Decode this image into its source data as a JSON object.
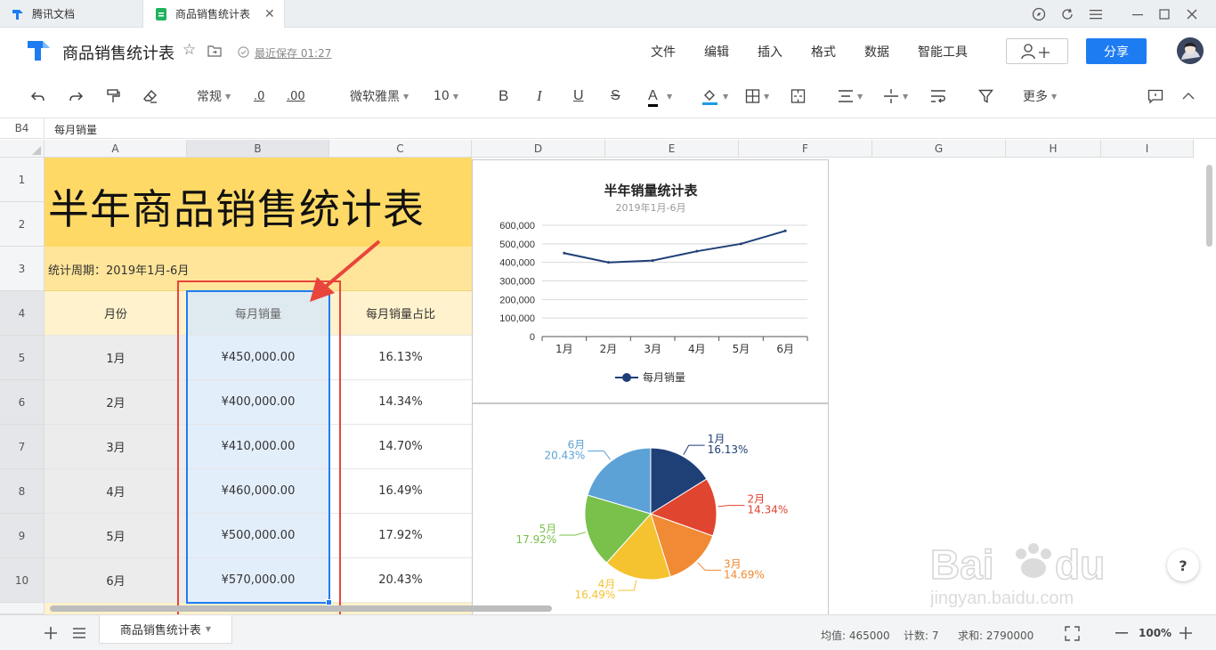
{
  "tabs": [
    {
      "label": "腾讯文档"
    },
    {
      "label": "商品销售统计表"
    }
  ],
  "header": {
    "doc_title": "商品销售统计表",
    "save_status": "最近保存 01:27",
    "menu": [
      "文件",
      "编辑",
      "插入",
      "格式",
      "数据",
      "智能工具"
    ],
    "share_label": "分享"
  },
  "toolbar": {
    "format_label": "常规",
    "decimal_dec": ".0",
    "decimal_inc": ".00",
    "font_name": "微软雅黑",
    "font_size": "10",
    "more_label": "更多",
    "bold": "B",
    "italic": "I",
    "underline": "U",
    "strike": "S",
    "font_color": "A"
  },
  "formula_bar": {
    "cell_ref": "B4",
    "content": "每月销量"
  },
  "columns": [
    "A",
    "B",
    "C",
    "D",
    "E",
    "F",
    "G",
    "H",
    "I"
  ],
  "rows": [
    "1",
    "2",
    "3",
    "4",
    "5",
    "6",
    "7",
    "8",
    "9",
    "10"
  ],
  "sheet": {
    "title": "半年商品销售统计表",
    "period": "统计周期：2019年1月-6月",
    "headers": [
      "月份",
      "每月销量",
      "每月销量占比"
    ],
    "data": [
      [
        "1月",
        "¥450,000.00",
        "16.13%"
      ],
      [
        "2月",
        "¥400,000.00",
        "14.34%"
      ],
      [
        "3月",
        "¥410,000.00",
        "14.70%"
      ],
      [
        "4月",
        "¥460,000.00",
        "16.49%"
      ],
      [
        "5月",
        "¥500,000.00",
        "17.92%"
      ],
      [
        "6月",
        "¥570,000.00",
        "20.43%"
      ]
    ]
  },
  "chart_data": [
    {
      "type": "line",
      "title": "半年销量统计表",
      "subtitle": "2019年1月-6月",
      "categories": [
        "1月",
        "2月",
        "3月",
        "4月",
        "5月",
        "6月"
      ],
      "series": [
        {
          "name": "每月销量",
          "values": [
            450000,
            400000,
            410000,
            460000,
            500000,
            570000
          ]
        }
      ],
      "ylim": [
        0,
        600000
      ],
      "yticks": [
        "600,000",
        "500,000",
        "400,000",
        "300,000",
        "200,000",
        "100,000",
        "0"
      ],
      "grid": true,
      "legend": "bottom",
      "color": "#1f3f77"
    },
    {
      "type": "pie",
      "categories": [
        "1月",
        "2月",
        "3月",
        "4月",
        "5月",
        "6月"
      ],
      "values": [
        16.13,
        14.34,
        14.69,
        16.49,
        17.92,
        20.43
      ],
      "labels": [
        "16.13%",
        "14.34%",
        "14.69%",
        "16.49%",
        "17.92%",
        "20.43%"
      ],
      "colors": [
        "#1f3f77",
        "#e0452f",
        "#f08a34",
        "#f5c330",
        "#79c14a",
        "#5ca2d6"
      ]
    }
  ],
  "statusbar": {
    "sheet_tab": "商品销售统计表",
    "avg": "均值: 465000",
    "count": "计数: 7",
    "sum": "求和: 2790000",
    "zoom": "100%"
  },
  "watermark": "Baidu经验 jingyan.baidu.com",
  "colors": {
    "accent": "#1e7cf2",
    "title_fill": "#ffd966",
    "period_fill": "#ffe599",
    "header_fill": "#fff2cc",
    "selection": "#e3eefb",
    "annotation_red": "#e8453c"
  }
}
